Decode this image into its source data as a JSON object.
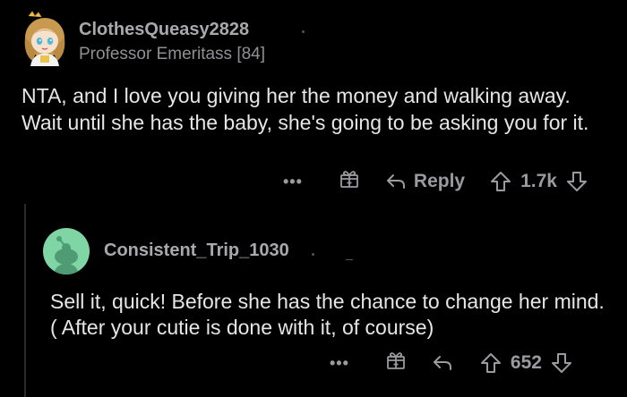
{
  "comment1": {
    "username": "ClothesQueasy2828",
    "flair": "Professor Emeritass [84]",
    "body": "NTA, and I love you giving her the money and walking away.  Wait until she has the baby, she's going to be asking you for it.",
    "more": "•••",
    "reply_label": "Reply",
    "vote_count": "1.7k"
  },
  "comment2": {
    "username": "Consistent_Trip_1030",
    "body": "Sell it, quick! Before she has the chance to change her mind. ( After your cutie is done with it, of course)",
    "more": "•••",
    "vote_count": "652"
  },
  "icons": {
    "gift": "gift-icon",
    "reply": "reply-arrow-icon",
    "upvote": "upvote-arrow-icon",
    "downvote": "downvote-arrow-icon"
  },
  "colors": {
    "background": "#000000",
    "text": "#e6e6e6",
    "meta": "#a9a9ad",
    "action": "#9a9a9f",
    "snoo_bg": "#7fd6a4"
  }
}
